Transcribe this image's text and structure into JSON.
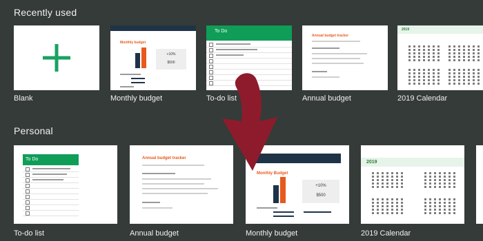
{
  "sections": {
    "recent": {
      "title": "Recently used"
    },
    "personal": {
      "title": "Personal"
    }
  },
  "recent_tiles": [
    {
      "label": "Blank"
    },
    {
      "label": "Monthly budget",
      "heading": "Monthly budget",
      "percent": "+10%",
      "amount": "$500"
    },
    {
      "label": "To-do list",
      "heading": "To Do"
    },
    {
      "label": "Annual budget",
      "heading": "Annual budget tracker"
    },
    {
      "label": "2019 Calendar",
      "year": "2019"
    }
  ],
  "personal_tiles": [
    {
      "label": "To-do list",
      "heading": "To Do"
    },
    {
      "label": "Annual budget",
      "heading": "Annual budget tracker"
    },
    {
      "label": "Monthly budget",
      "heading": "Monthly Budget",
      "percent": "+10%",
      "amount": "$500"
    },
    {
      "label": "2019 Calendar",
      "year": "2019"
    }
  ],
  "colors": {
    "background": "#353b38",
    "plus": "#1aa260",
    "arrow": "#8e1b2c",
    "calendar_band": "#e6f4ea",
    "todo_header": "#0f9d58",
    "budget_orange": "#e8591e",
    "budget_navy": "#1f3347"
  }
}
